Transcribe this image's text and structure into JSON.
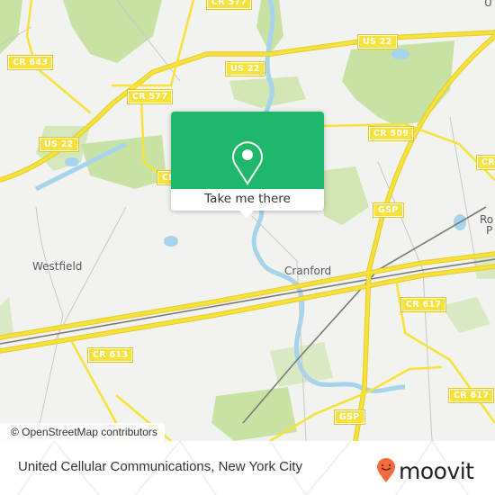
{
  "map": {
    "road_shields": [
      {
        "id": "cr-577-top",
        "label": "CR 577"
      },
      {
        "id": "cr-643",
        "label": "CR 643"
      },
      {
        "id": "us-22-top",
        "label": "US 22"
      },
      {
        "id": "us-22-mid",
        "label": "US 22"
      },
      {
        "id": "cr-577",
        "label": "CR 577"
      },
      {
        "id": "us-22-left",
        "label": "US 22"
      },
      {
        "id": "cr-509",
        "label": "CR 509"
      },
      {
        "id": "cr-right-top",
        "label": "CR"
      },
      {
        "id": "gsp-top",
        "label": "GSP"
      },
      {
        "id": "cr-617-a",
        "label": "CR 617"
      },
      {
        "id": "cr-613",
        "label": "CR 613"
      },
      {
        "id": "cr-617-b",
        "label": "CR 617"
      },
      {
        "id": "gsp-bottom",
        "label": "GSP"
      },
      {
        "id": "cr-left-edge",
        "label": "CR"
      }
    ],
    "places": [
      {
        "id": "westfield",
        "label": "Westfield"
      },
      {
        "id": "cranford",
        "label": "Cranford"
      },
      {
        "id": "roselle-park-1",
        "label": "Ro"
      },
      {
        "id": "roselle-park-2",
        "label": "P"
      },
      {
        "id": "union",
        "label": "U"
      }
    ],
    "colors": {
      "land": "#f2f2ee",
      "park": "#c8e2a4",
      "water": "#a6d4ec",
      "road": "#f7e13b",
      "rail": "#7a7a7a",
      "accent": "#1fb86b"
    },
    "attribution": "© OpenStreetMap contributors"
  },
  "popup": {
    "icon": "map-pin-icon",
    "button_label": "Take me there"
  },
  "footer": {
    "title": "United Cellular Communications, New York City",
    "brand": "moovit",
    "brand_color": "#f26b3a"
  }
}
